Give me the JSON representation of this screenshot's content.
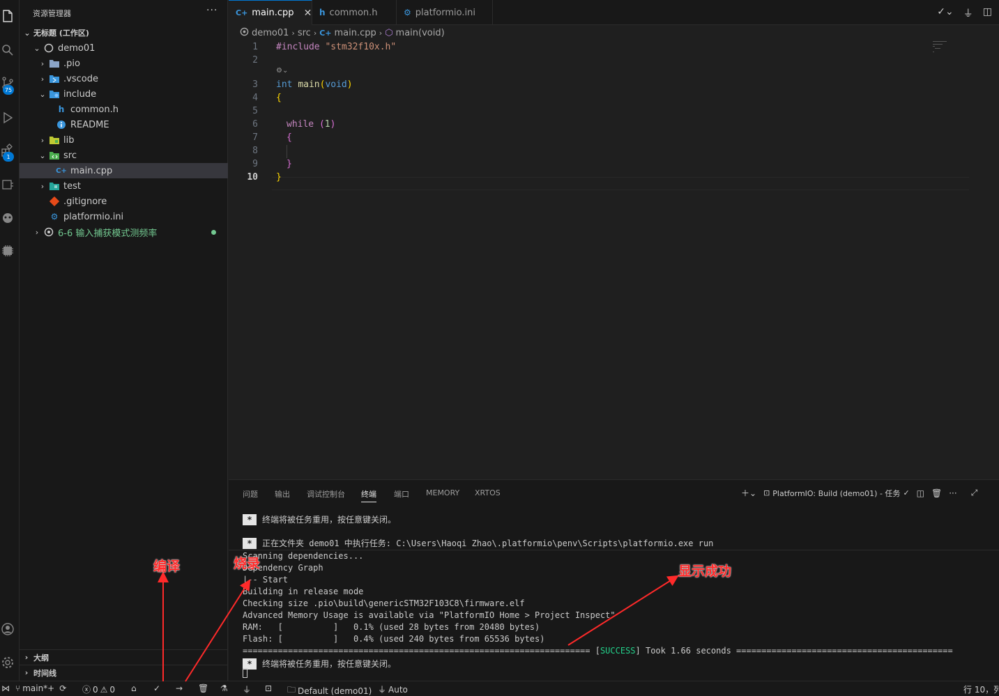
{
  "sidebar": {
    "title": "资源管理器",
    "more": "···",
    "workspace": "无标题 (工作区)",
    "tree": [
      {
        "label": "demo01"
      },
      {
        "label": ".pio"
      },
      {
        "label": ".vscode"
      },
      {
        "label": "include"
      },
      {
        "label": "common.h"
      },
      {
        "label": "README"
      },
      {
        "label": "lib"
      },
      {
        "label": "src"
      },
      {
        "label": "main.cpp"
      },
      {
        "label": "test"
      },
      {
        "label": ".gitignore"
      },
      {
        "label": "platformio.ini"
      },
      {
        "label": "6-6 输入捕获模式测频率"
      }
    ],
    "outline": "大纲",
    "timeline": "时间线"
  },
  "activity": {
    "badge_scm": "75",
    "badge_ext": "1"
  },
  "tabs": [
    {
      "label": "main.cpp",
      "icon": "C+"
    },
    {
      "label": "common.h",
      "icon": "h"
    },
    {
      "label": "platformio.ini",
      "icon": "⚙"
    }
  ],
  "breadcrumb": [
    "demo01",
    "src",
    "main.cpp",
    "main(void)"
  ],
  "editor": {
    "line_numbers": [
      "1",
      "2",
      "3",
      "4",
      "5",
      "6",
      "7",
      "8",
      "9",
      "10"
    ],
    "code": {
      "l1_pre": "#include",
      "l1_str": "\"stm32f10x.h\"",
      "l3_kw": "int",
      "l3_fn": "main",
      "l3_open": "(",
      "l3_void": "void",
      "l3_close": ")",
      "l4": "{",
      "l6_kw": "while",
      "l6_open": " (",
      "l6_num": "1",
      "l6_close": ")",
      "l7": "{",
      "l9": "}",
      "l10": "}"
    }
  },
  "panel": {
    "tabs": [
      "问题",
      "输出",
      "调试控制台",
      "终端",
      "端口",
      "MEMORY",
      "XRTOS"
    ],
    "active_tab": "终端",
    "task_label": "PlatformIO: Build (demo01) - 任务",
    "terminal": {
      "star": "*",
      "line1": "终端将被任务重用，按任意键关闭。",
      "line2": "正在文件夹 demo01 中执行任务: C:\\Users\\Haoqi Zhao\\.platformio\\penv\\Scripts\\platformio.exe run",
      "line3": "Scanning dependencies...",
      "line4": "Dependency Graph",
      "line5": "|-- Start",
      "line6": "Building in release mode",
      "line7": "Checking size .pio\\build\\genericSTM32F103C8\\firmware.elf",
      "line8": "Advanced Memory Usage is available via \"PlatformIO Home > Project Inspect\"",
      "line9": "RAM:   [          ]   0.1% (used 28 bytes from 20480 bytes)",
      "line10": "Flash: [          ]   0.4% (used 240 bytes from 65536 bytes)",
      "sep_left": "===================================================================== [",
      "success": "SUCCESS",
      "sep_right": "] Took 1.66 seconds ===========================================",
      "line12": "终端将被任务重用，按任意键关闭。"
    }
  },
  "status": {
    "branch": "main*+",
    "errors": "0",
    "warnings": "0",
    "env": "Default (demo01)",
    "auto": "Auto",
    "position": "行 10，列"
  },
  "annotations": {
    "compile": "编译",
    "upload": "烧录",
    "success": "显示成功"
  },
  "colors": {
    "accent": "#0078d4",
    "annotation": "#ff2a2a",
    "success": "#23d18b",
    "git_modified": "#73c991"
  }
}
